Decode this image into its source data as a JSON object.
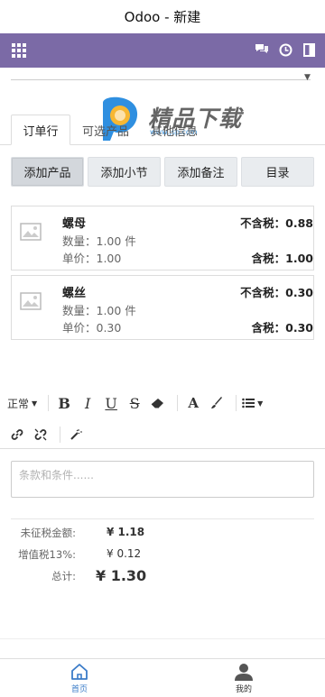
{
  "window": {
    "title": "Odoo - 新建"
  },
  "navbar": {
    "icons": [
      "apps-icon",
      "chat-icon",
      "clock-icon",
      "split-icon"
    ],
    "color": "#7b6aa6"
  },
  "watermark": {
    "text": "精品下载",
    "url": "www.jsp.com"
  },
  "tabs": [
    "订单行",
    "可选产品",
    "其他信息"
  ],
  "actions": {
    "add_product": "添加产品",
    "add_section": "添加小节",
    "add_note": "添加备注",
    "catalog": "目录"
  },
  "lines": [
    {
      "name": "螺母",
      "qty": "数量：1.00 件",
      "price": "单价：1.00",
      "excl": "不含税：0.88",
      "incl": "含税：1.00"
    },
    {
      "name": "螺丝",
      "qty": "数量：1.00 件",
      "price": "单价：0.30",
      "excl": "不含税：0.30",
      "incl": "含税：0.30"
    }
  ],
  "editor": {
    "style_label": "正常"
  },
  "terms": {
    "placeholder": "条款和条件......"
  },
  "totals": {
    "untaxed_label": "未征税金额:",
    "untaxed_value": "¥ 1.18",
    "tax_label": "增值税13%:",
    "tax_value": "¥ 0.12",
    "total_label": "总计:",
    "total_value": "¥ 1.30"
  },
  "bottom_nav": {
    "home": "首页",
    "me": "我的",
    "accent": "#3a7bc8"
  }
}
